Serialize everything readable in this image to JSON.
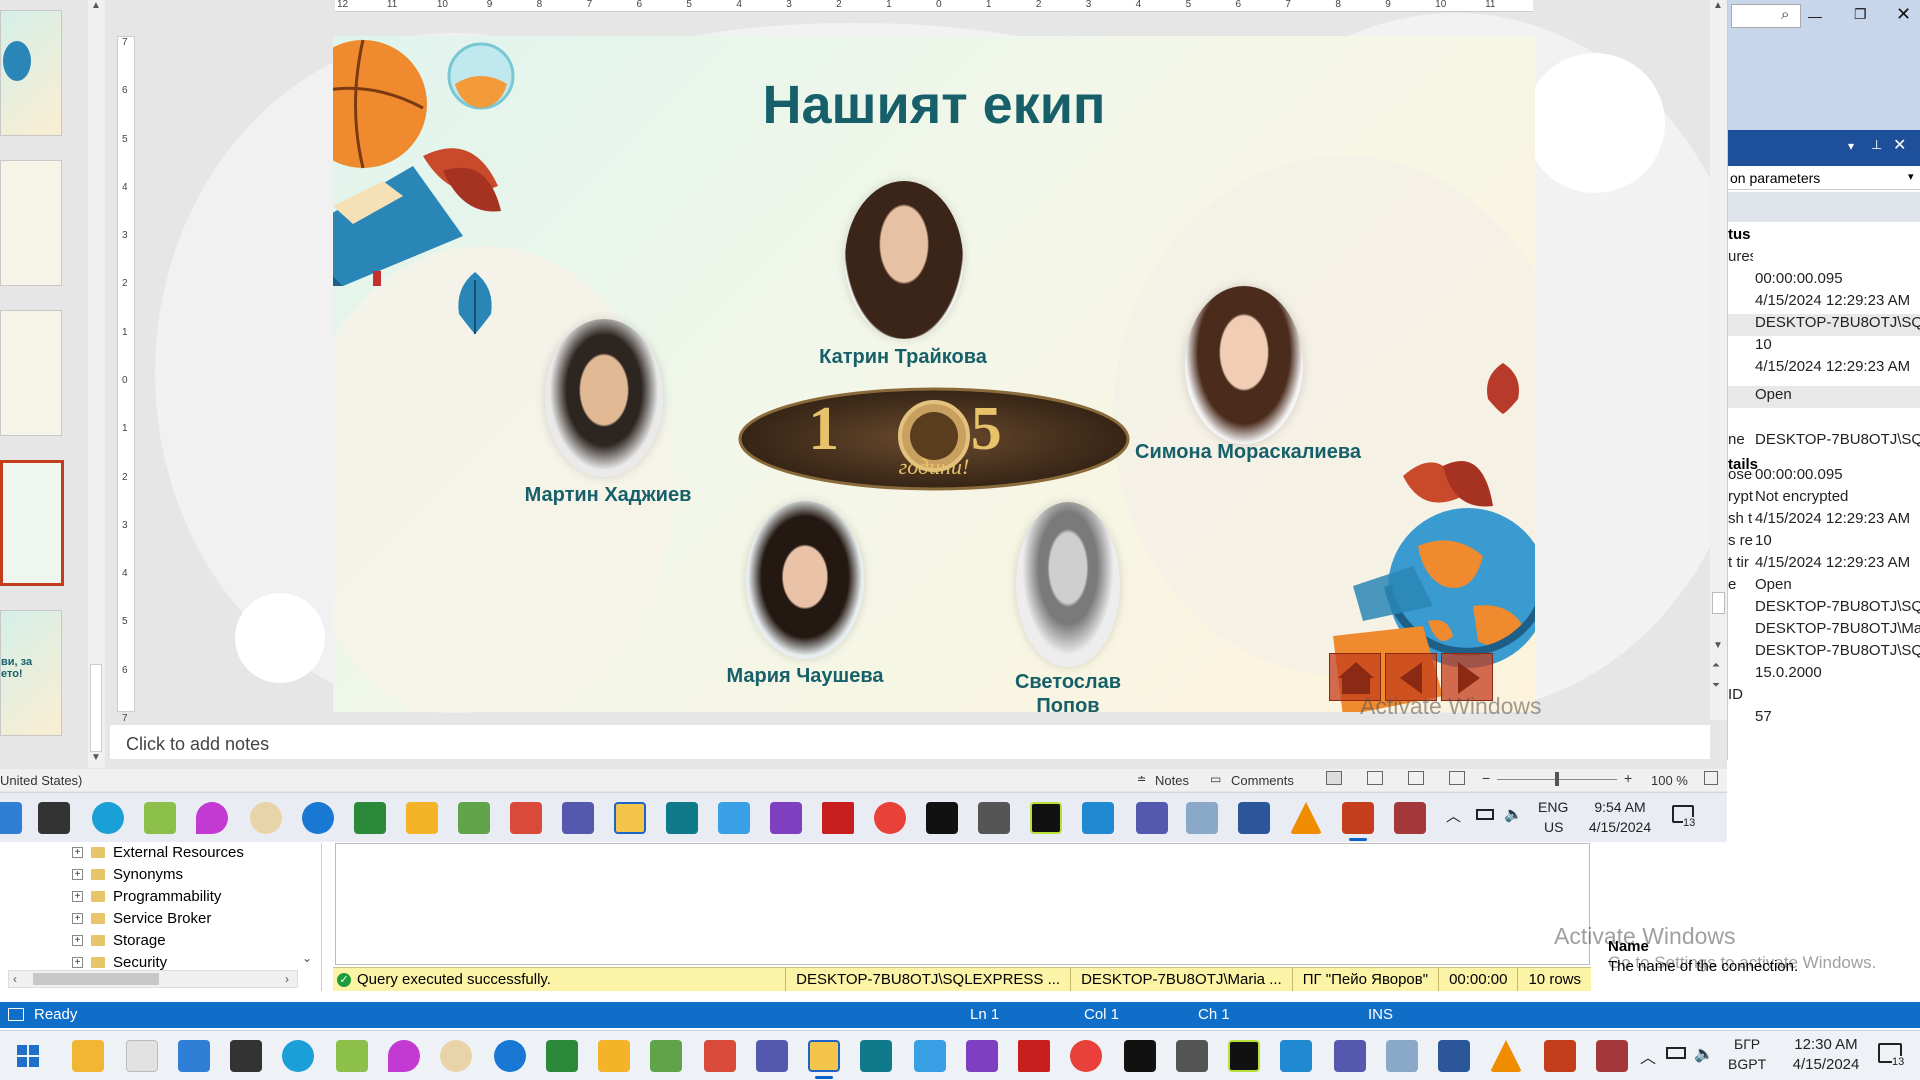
{
  "ssms": {
    "tree": [
      "External Resources",
      "Synonyms",
      "Programmability",
      "Service Broker",
      "Storage",
      "Security"
    ],
    "query_status": {
      "message": "Query executed successfully.",
      "server": "DESKTOP-7BU8OTJ\\SQLEXPRESS ...",
      "user": "DESKTOP-7BU8OTJ\\Maria ...",
      "database": "ПГ \"Пейо Яворов\"",
      "time": "00:00:00",
      "rows": "10 rows"
    },
    "status_bar": {
      "ready": "Ready",
      "ln": "Ln 1",
      "col": "Col 1",
      "ch": "Ch 1",
      "ins": "INS"
    },
    "props_bottom": {
      "title": "Name",
      "desc": "The name of the connection."
    },
    "watermark": {
      "title": "Activate Windows",
      "sub": "Go to Settings to activate Windows."
    },
    "tray": {
      "lang1": "БГР",
      "lang2": "BGPT",
      "time": "12:30 AM",
      "date": "4/15/2024",
      "notif": "13"
    }
  },
  "props_panel": {
    "dropdown": "on parameters",
    "sections": [
      "tus",
      "tails"
    ],
    "rows": [
      {
        "k": "ures",
        "v": ""
      },
      {
        "k": "",
        "v": "00:00:00.095"
      },
      {
        "k": "",
        "v": "4/15/2024 12:29:23 AM"
      },
      {
        "k": "",
        "v": "DESKTOP-7BU8OTJ\\SQL"
      },
      {
        "k": "",
        "v": "10"
      },
      {
        "k": "",
        "v": "4/15/2024 12:29:23 AM"
      },
      {
        "k": "",
        "v": "Open"
      },
      {
        "k": "ne",
        "v": "DESKTOP-7BU8OTJ\\SQL"
      },
      {
        "k": "osec",
        "v": "00:00:00.095"
      },
      {
        "k": "rypt",
        "v": "Not encrypted"
      },
      {
        "k": "sh ti",
        "v": "4/15/2024 12:29:23 AM"
      },
      {
        "k": "s re",
        "v": "10"
      },
      {
        "k": "t tir",
        "v": "4/15/2024 12:29:23 AM"
      },
      {
        "k": "e",
        "v": "Open"
      },
      {
        "k": "",
        "v": "DESKTOP-7BU8OTJ\\SQL"
      },
      {
        "k": "",
        "v": "DESKTOP-7BU8OTJ\\Mar"
      },
      {
        "k": "",
        "v": "DESKTOP-7BU8OTJ\\SQL"
      },
      {
        "k": "",
        "v": "15.0.2000"
      },
      {
        "k": "ID",
        "v": ""
      },
      {
        "k": "",
        "v": "57"
      }
    ]
  },
  "slide": {
    "title": "Нашият екип",
    "badge_numbers": "1  5",
    "badge_word": "години!",
    "members": [
      {
        "name": "Катрин Трайкова"
      },
      {
        "name": "Мартин Хаджиев"
      },
      {
        "name": "Симона Мораскалиева"
      },
      {
        "name": "Мария Чаушева"
      },
      {
        "name": "Светослав Попов"
      }
    ]
  },
  "ruler_labels": [
    "12",
    "11",
    "10",
    "9",
    "8",
    "7",
    "6",
    "5",
    "4",
    "3",
    "2",
    "1",
    "0",
    "1",
    "2",
    "3",
    "4",
    "5",
    "6",
    "7",
    "8",
    "9",
    "10",
    "11",
    "12"
  ],
  "vruler_labels": [
    "7",
    "6",
    "5",
    "4",
    "3",
    "2",
    "1",
    "0",
    "1",
    "2",
    "3",
    "4",
    "5",
    "6",
    "7"
  ],
  "notes_placeholder": "Click to add notes",
  "ppt_status": {
    "lang": "United States)",
    "notes": "Notes",
    "comments": "Comments",
    "zoom": "100 %"
  },
  "ppt_tray": {
    "lang1": "ENG",
    "lang2": "US",
    "time": "9:54 AM",
    "date": "4/15/2024",
    "notif": "13"
  },
  "colors": {
    "accent": "#17606a",
    "status_blue": "#0e6ec8",
    "query_yellow": "#fbf3a6"
  }
}
